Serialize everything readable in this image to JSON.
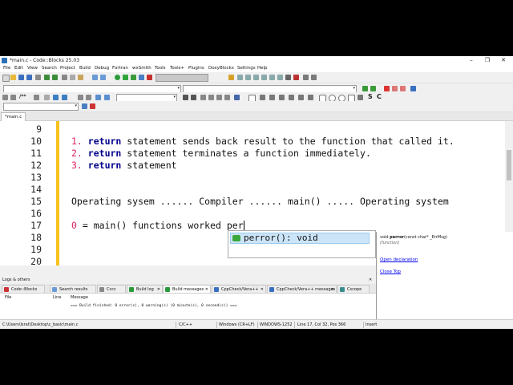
{
  "window": {
    "title": "*main.c - Code::Blocks 25.03",
    "minimize": "–",
    "maximize": "❐",
    "close": "✕"
  },
  "menu": [
    "File",
    "Edit",
    "View",
    "Search",
    "Project",
    "Build",
    "Debug",
    "Fortran",
    "wxSmith",
    "Tools",
    "Tools+",
    "Plugins",
    "DoxyBlocks",
    "Settings",
    "Help"
  ],
  "toolbar": {
    "comment_glyph": "/**",
    "glyph_S": "S",
    "glyph_C": "C"
  },
  "editor": {
    "tab_label": "*main.c",
    "lines": [
      {
        "n": "9",
        "num": "",
        "kw": "",
        "text": ""
      },
      {
        "n": "10",
        "num": "1.",
        "kw": "return",
        "text": " statement sends back result to the function that called it."
      },
      {
        "n": "11",
        "num": "2.",
        "kw": "return",
        "text": " statement terminates a function immediately."
      },
      {
        "n": "12",
        "num": "3.",
        "kw": "return",
        "text": " statement"
      },
      {
        "n": "13",
        "num": "",
        "kw": "",
        "text": ""
      },
      {
        "n": "14",
        "num": "",
        "kw": "",
        "text": ""
      },
      {
        "n": "15",
        "num": "",
        "kw": "",
        "text": "Operating sysem ...... Compiler ...... main() ..... Operating system"
      },
      {
        "n": "16",
        "num": "",
        "kw": "",
        "text": ""
      },
      {
        "n": "17",
        "num": "0",
        "kw": "",
        "text": " = main() functions worked per"
      },
      {
        "n": "18",
        "num": "",
        "kw": "",
        "text": ""
      },
      {
        "n": "19",
        "num": "",
        "kw": "",
        "text": ""
      },
      {
        "n": "20",
        "num": "",
        "kw": "",
        "text": ""
      }
    ]
  },
  "autocomplete": {
    "item": "perror(): void"
  },
  "doc_panel": {
    "sig_pre": "void ",
    "sig_name": "perror",
    "sig_post": "(const char* _ErrMsg)",
    "kind": "(function)",
    "open_link": "Open declaration",
    "close_link": "Close Top"
  },
  "logs": {
    "header": "Logs & others",
    "close": "✕",
    "tabs": [
      "Code::Blocks",
      "Search results",
      "Cccc",
      "Build log",
      "Build messages",
      "CppCheck/Vera++",
      "CppCheck/Vera++ messages",
      "Cscope"
    ],
    "columns": [
      "File",
      "Line",
      "Message"
    ],
    "message": "=== Build finished: 0 error(s), 0 warning(s) (0 minute(s), 0 second(s)) ==="
  },
  "status": {
    "path": "C:\\Users\\Israt\\Desktop\\c_basic\\main.c",
    "language": "C/C++",
    "eol": "Windows (CR+LF)",
    "encoding": "WINDOWS-1252",
    "position": "Line 17, Col 32, Pos 366",
    "mode": "Insert"
  },
  "colors": {
    "changebar": "#f7c21c",
    "keyword": "#00008b",
    "list_number": "#e0245e",
    "ac_highlight": "#cce4f7"
  }
}
